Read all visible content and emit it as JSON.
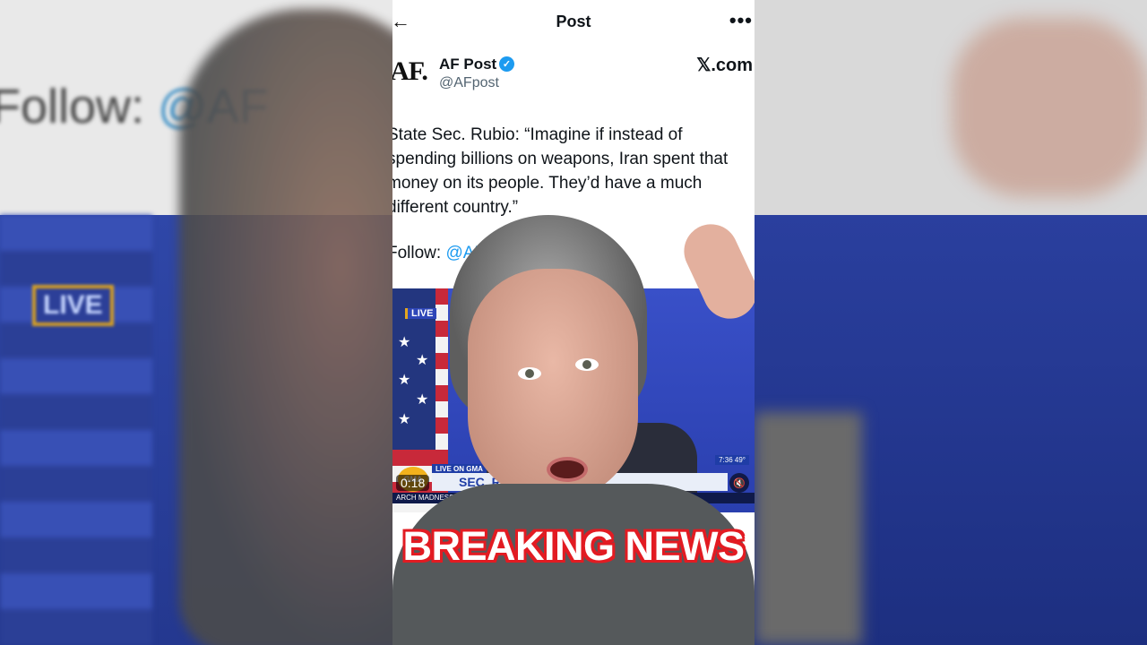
{
  "background": {
    "left_follow_text": "Follow: ",
    "left_follow_handle": "@AF",
    "left_live_badge": "LIVE"
  },
  "header": {
    "back_icon": "arrow-left-icon",
    "title": "Post",
    "more_icon": "more-horizontal-icon",
    "more_glyph": "•••"
  },
  "account": {
    "avatar_text": "AF.",
    "name": "AF Post",
    "verified_icon": "verified-badge-icon",
    "handle": "@AFpost",
    "watermark": "𝕏.com"
  },
  "post": {
    "text": "State Sec. Rubio: “Imagine if instead of spending billions on weapons, Iran spent that money on its people. They’d have a much different country.”",
    "follow_label": "Follow: ",
    "follow_link": "@AF"
  },
  "video": {
    "live_badge": "LIVE",
    "lower_third_live": "LIVE ON GMA",
    "lower_third_headline": "SEC. RUBIO          WITH IRAN",
    "ticker": "ARCH MADNESS",
    "logo": "GMA",
    "clock": "7:36  49°",
    "duration": "0:18",
    "mute_icon": "mute-icon"
  },
  "overlay": {
    "caption": "BREAKING NEWS"
  },
  "colors": {
    "accent_link": "#1d9bf0",
    "caption_outline": "#e21b22",
    "caption_fill": "#ffffff"
  }
}
